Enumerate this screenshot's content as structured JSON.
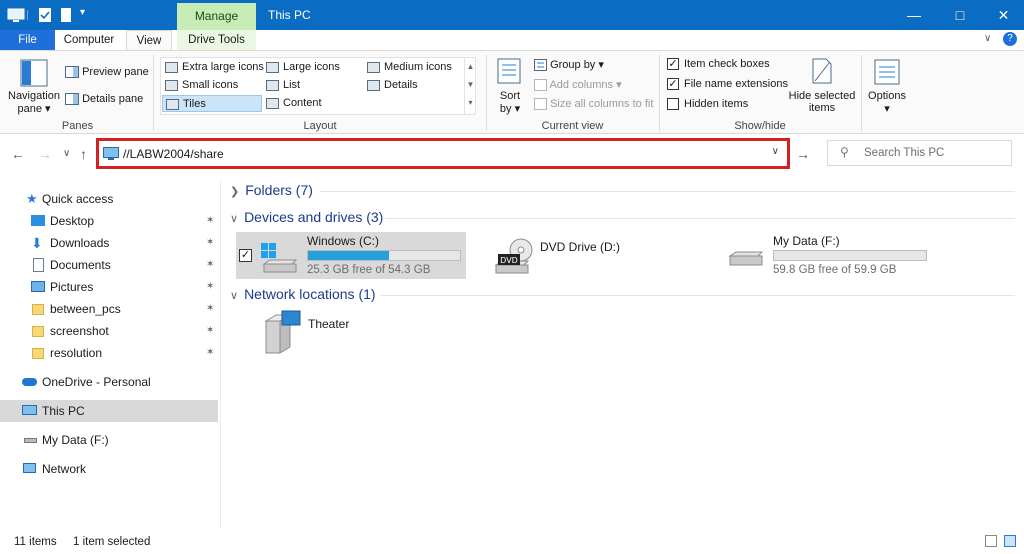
{
  "window": {
    "context_tab": "Manage",
    "title": "This PC"
  },
  "tabs": {
    "file": "File",
    "computer": "Computer",
    "view": "View",
    "drive_tools": "Drive Tools"
  },
  "ribbon": {
    "panes": {
      "label": "Panes",
      "navigation_pane": "Navigation",
      "navigation_pane_2": "pane",
      "preview_pane": "Preview pane",
      "details_pane": "Details pane"
    },
    "layout": {
      "label": "Layout",
      "items": [
        "Extra large icons",
        "Large icons",
        "Medium icons",
        "Small icons",
        "List",
        "Details",
        "Tiles",
        "Content"
      ]
    },
    "current_view": {
      "label": "Current view",
      "sort_by": "Sort",
      "sort_by_2": "by",
      "group_by": "Group by",
      "add_columns": "Add columns",
      "size_columns": "Size all columns to fit"
    },
    "show_hide": {
      "label": "Show/hide",
      "item_check_boxes": "Item check boxes",
      "file_name_extensions": "File name extensions",
      "hidden_items": "Hidden items",
      "item_check_boxes_checked": true,
      "file_name_extensions_checked": true,
      "hidden_items_checked": false,
      "hide_selected": "Hide selected",
      "hide_selected_2": "items"
    },
    "options": "Options"
  },
  "address": {
    "path": "//LABW2004/share",
    "search_placeholder": "Search This PC"
  },
  "sidebar": {
    "quick_access": "Quick access",
    "items": [
      "Desktop",
      "Downloads",
      "Documents",
      "Pictures",
      "between_pcs",
      "screenshot",
      "resolution"
    ],
    "onedrive": "OneDrive - Personal",
    "this_pc": "This PC",
    "my_data": "My Data (F:)",
    "network": "Network"
  },
  "content": {
    "folders_header": "Folders (7)",
    "devices_header": "Devices and drives (3)",
    "network_header": "Network locations (1)",
    "drives": [
      {
        "name": "Windows (C:)",
        "free": "25.3 GB free of 54.3 GB",
        "used_fraction": 0.53
      },
      {
        "name": "DVD Drive (D:)"
      },
      {
        "name": "My Data (F:)",
        "free": "59.8 GB free of 59.9 GB",
        "used_fraction": 0.002
      }
    ],
    "network_locations": [
      {
        "name": "Theater"
      }
    ],
    "dvd_badge": "DVD"
  },
  "status": {
    "count": "11 items",
    "selected": "1 item selected"
  },
  "colors": {
    "titlebar": "#0b6cc4",
    "accent": "#26a0da",
    "highlight": "#d42020"
  }
}
